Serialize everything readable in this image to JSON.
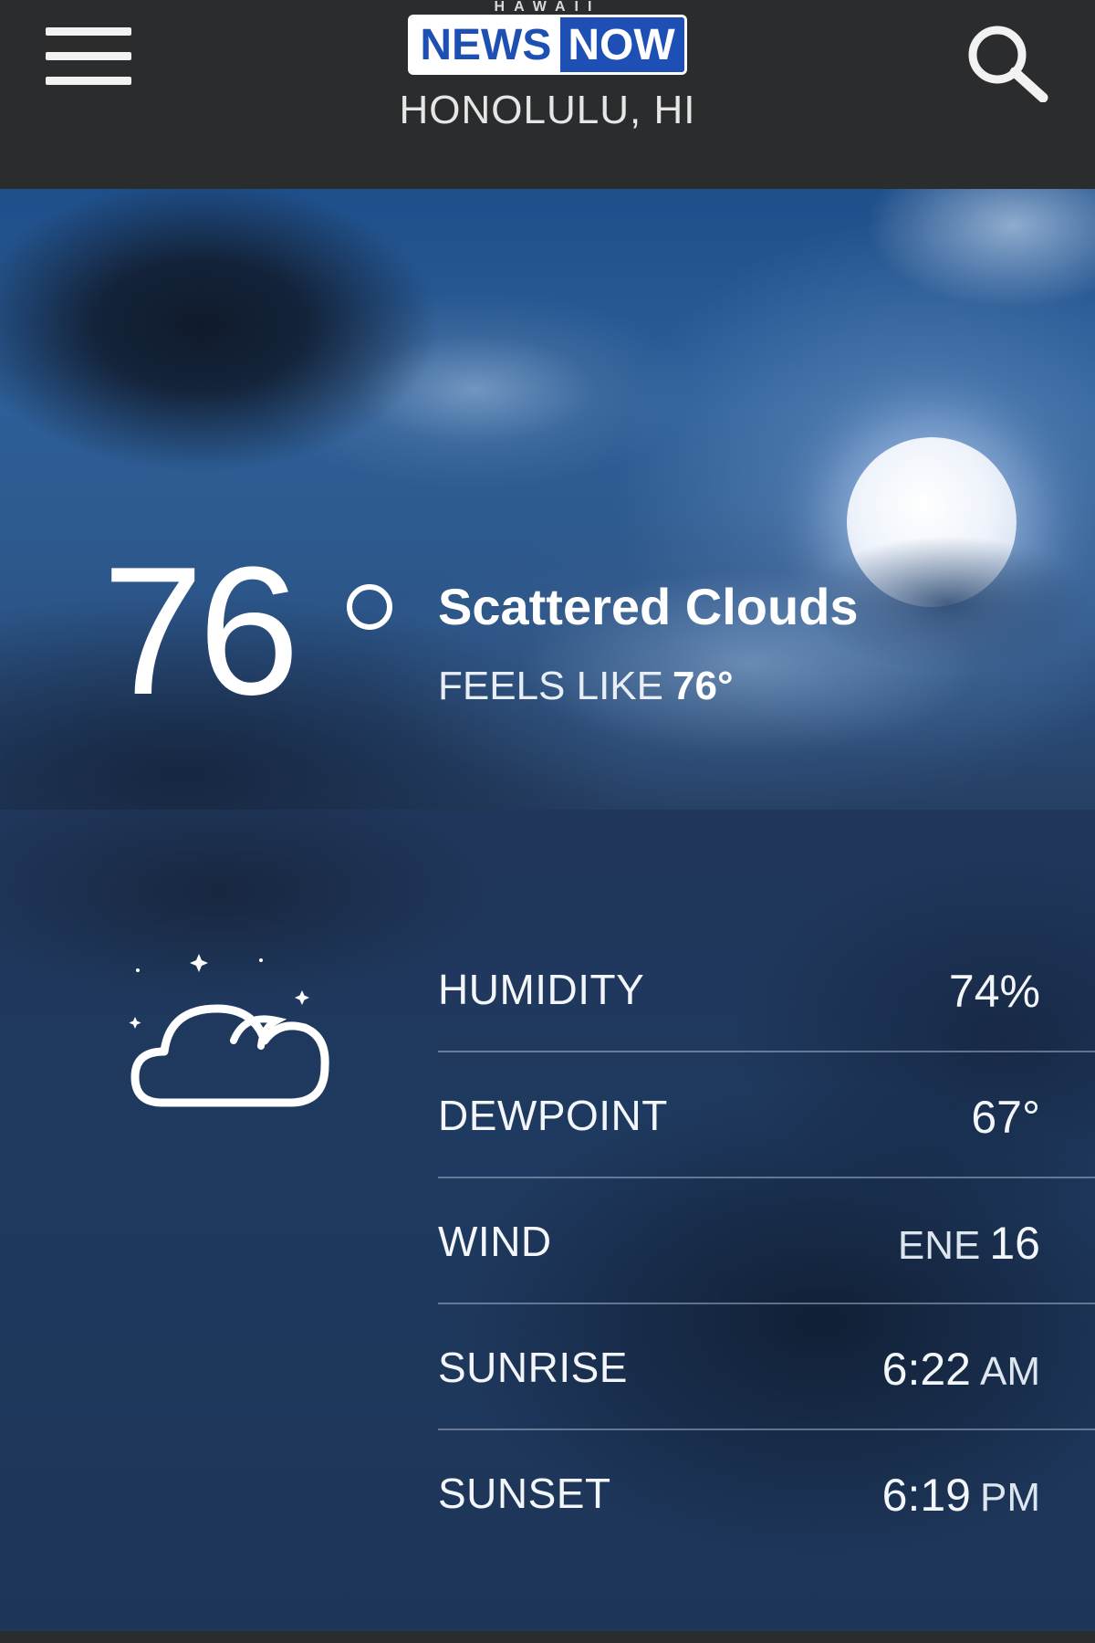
{
  "header": {
    "logo_top": "HAWAII",
    "logo_news": "NEWS",
    "logo_now": "NOW",
    "location": "HONOLULU, HI",
    "menu_icon": "hamburger-menu-icon",
    "search_icon": "search-icon"
  },
  "current": {
    "temperature": "76",
    "condition": "Scattered Clouds",
    "feels_like_label": "FEELS LIKE",
    "feels_like_value": "76°",
    "condition_icon": "night-partly-cloudy-icon"
  },
  "details": {
    "humidity": {
      "label": "HUMIDITY",
      "value": "74%"
    },
    "dewpoint": {
      "label": "DEWPOINT",
      "value": "67°"
    },
    "wind": {
      "label": "WIND",
      "direction": "ENE",
      "speed": "16"
    },
    "sunrise": {
      "label": "SUNRISE",
      "time": "6:22",
      "period": "AM"
    },
    "sunset": {
      "label": "SUNSET",
      "time": "6:19",
      "period": "PM"
    }
  },
  "colors": {
    "header_bg": "#2b2c2e",
    "logo_blue": "#1e4fb5",
    "panel_bg": "#1f3a60"
  }
}
